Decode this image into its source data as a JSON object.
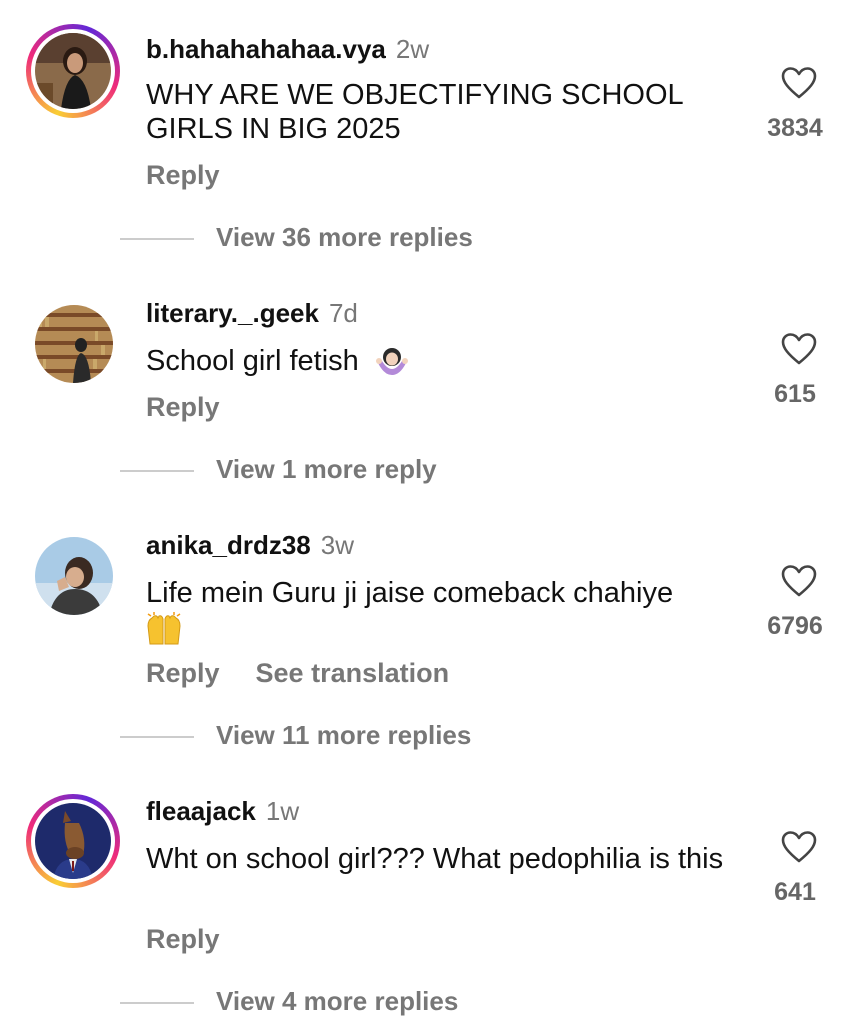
{
  "comments": [
    {
      "username": "b.hahahahahaa.vya",
      "time": "2w",
      "text": "WHY ARE WE OBJECTIFYING SCHOOL GIRLS IN BIG 2025",
      "reply_label": "Reply",
      "likes": "3834",
      "view_replies": "View 36 more replies",
      "avatar_icon": "profile-photo-woman",
      "story_ring": true
    },
    {
      "username": "literary._.geek",
      "time": "7d",
      "text": "School girl fetish",
      "reply_label": "Reply",
      "likes": "615",
      "view_replies": "View 1 more reply",
      "avatar_icon": "profile-photo-library",
      "story_ring": false
    },
    {
      "username": "anika_drdz38",
      "time": "3w",
      "text": "Life mein Guru ji jaise comeback chahiye",
      "reply_label": "Reply",
      "translate_label": "See translation",
      "likes": "6796",
      "view_replies": "View 11 more replies",
      "avatar_icon": "profile-photo-person",
      "story_ring": false
    },
    {
      "username": "fleaajack",
      "time": "1w",
      "text": "Wht on school girl??? What pedophilia is this",
      "reply_label": "Reply",
      "likes": "641",
      "view_replies": "View 4 more replies",
      "avatar_icon": "profile-photo-horse-cartoon",
      "story_ring": true
    }
  ],
  "colors": {
    "text": "#111111",
    "muted": "#777777",
    "divider": "#cccccc",
    "ring_gradient": [
      "#f9ce34",
      "#ee2a7b",
      "#6228d7"
    ]
  }
}
